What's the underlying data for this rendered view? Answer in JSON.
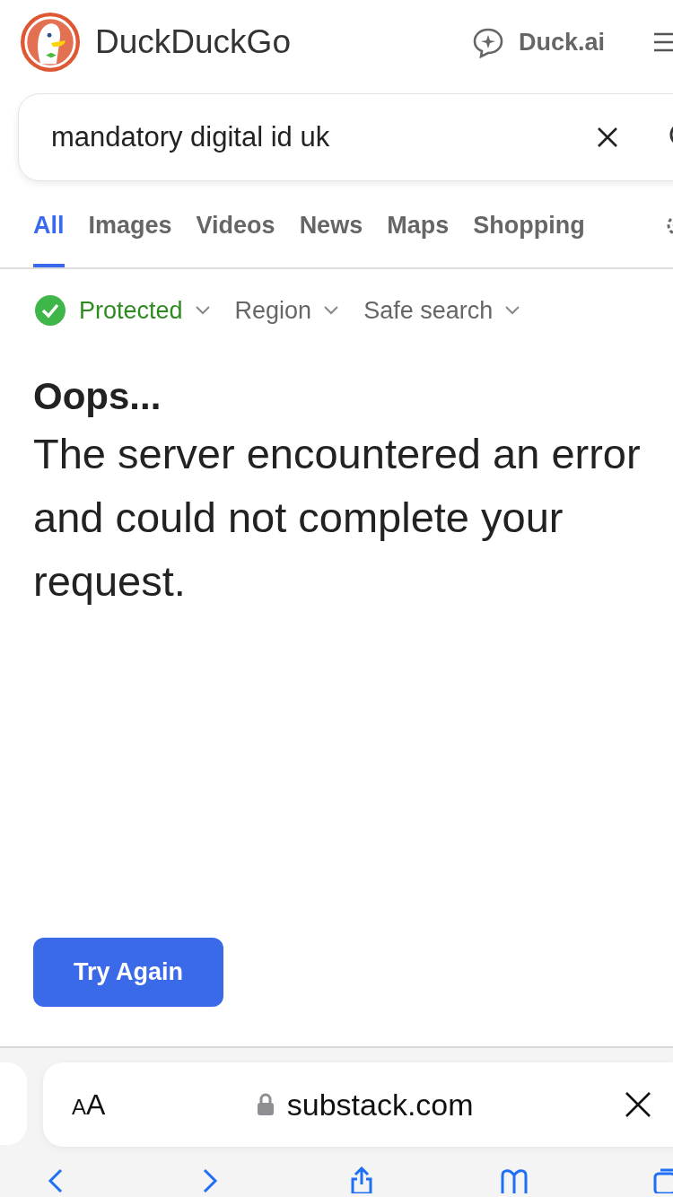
{
  "header": {
    "brand": "DuckDuckGo",
    "ai_link": "Duck.ai"
  },
  "search": {
    "value": "mandatory digital id uk"
  },
  "tabs": [
    {
      "label": "All",
      "selected": true
    },
    {
      "label": "Images",
      "selected": false
    },
    {
      "label": "Videos",
      "selected": false
    },
    {
      "label": "News",
      "selected": false
    },
    {
      "label": "Maps",
      "selected": false
    },
    {
      "label": "Shopping",
      "selected": false
    }
  ],
  "filters": [
    {
      "label": "Protected",
      "kind": "protection"
    },
    {
      "label": "Region",
      "kind": "dropdown"
    },
    {
      "label": "Safe search",
      "kind": "dropdown"
    }
  ],
  "error": {
    "title": "Oops...",
    "message": "The server encountered an error and could not complete your request.",
    "button": "Try Again"
  },
  "browser_bar": {
    "reader": "AA",
    "url": "substack.com"
  }
}
